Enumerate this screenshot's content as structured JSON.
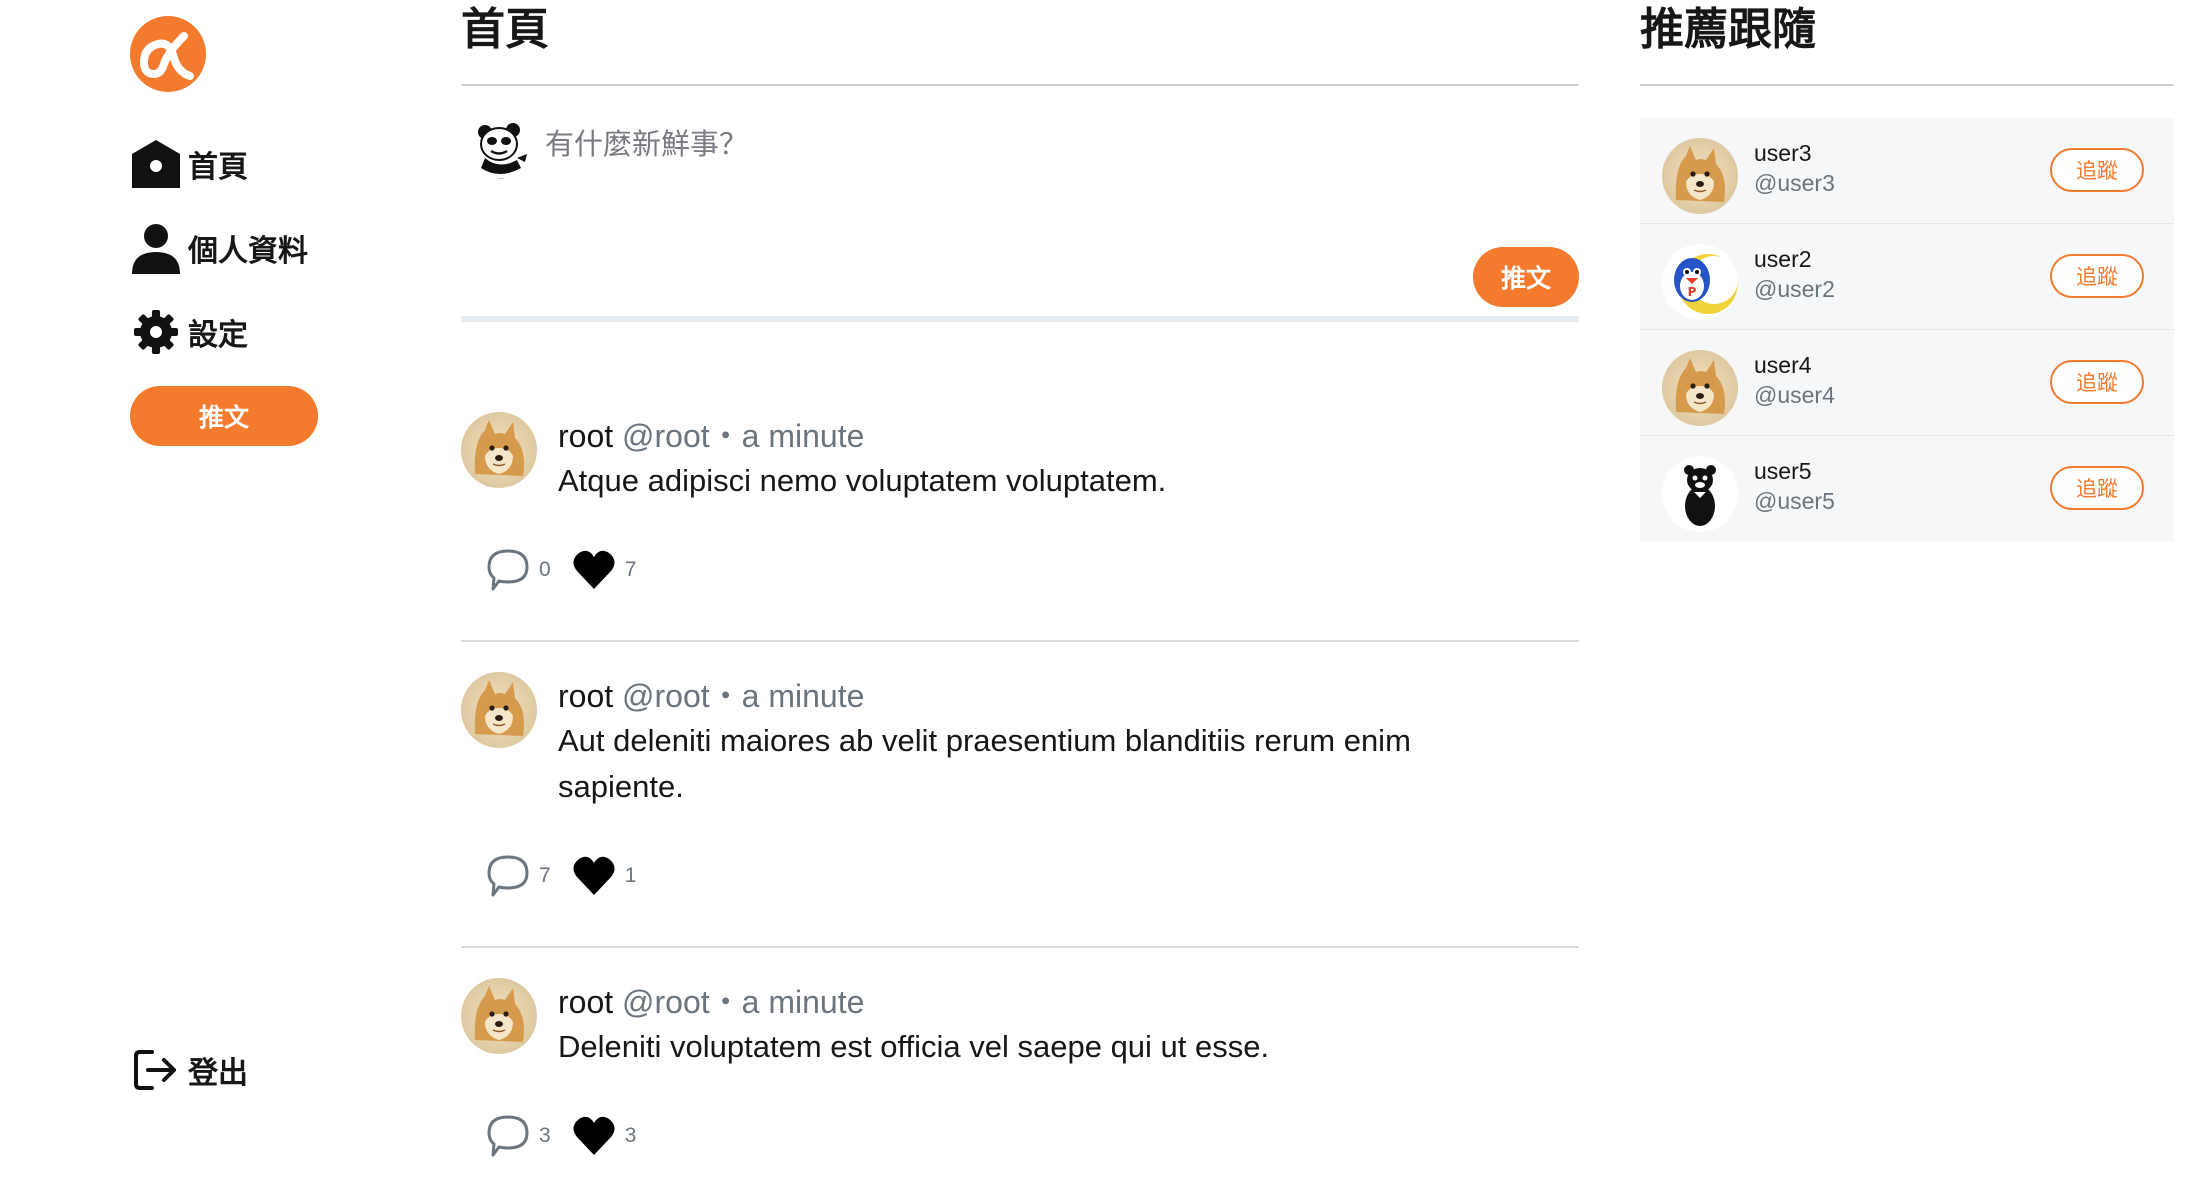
{
  "brand": {
    "logo_icon": "alpha-logo-icon",
    "accent_color": "#f47a2e"
  },
  "sidebar": {
    "items": [
      {
        "label": "首頁",
        "icon": "home-icon"
      },
      {
        "label": "個人資料",
        "icon": "user-icon"
      },
      {
        "label": "設定",
        "icon": "gear-icon"
      }
    ],
    "tweet_button": "推文",
    "logout": {
      "label": "登出",
      "icon": "logout-icon"
    }
  },
  "main": {
    "title": "首頁",
    "composer": {
      "placeholder": "有什麼新鮮事？",
      "submit_label": "推文",
      "avatar_icon": "panda-meme-avatar"
    },
    "tweets": [
      {
        "name": "root",
        "handle": "@root",
        "separator": "・",
        "time": "a minute",
        "body": "Atque adipisci nemo voluptatem voluptatem.",
        "replies": "0",
        "likes": "7"
      },
      {
        "name": "root",
        "handle": "@root",
        "separator": "・",
        "time": "a minute",
        "body": "Aut deleniti maiores ab velit praesentium blanditiis rerum enim sapiente.",
        "replies": "7",
        "likes": "1"
      },
      {
        "name": "root",
        "handle": "@root",
        "separator": "・",
        "time": "a minute",
        "body": "Deleniti voluptatem est officia vel saepe qui ut esse.",
        "replies": "3",
        "likes": "3"
      }
    ]
  },
  "right": {
    "title": "推薦跟隨",
    "suggestions": [
      {
        "name": "user3",
        "handle": "@user3",
        "follow_label": "追蹤",
        "avatar": "doge-avatar"
      },
      {
        "name": "user2",
        "handle": "@user2",
        "follow_label": "追蹤",
        "avatar": "penguin-moon-avatar"
      },
      {
        "name": "user4",
        "handle": "@user4",
        "follow_label": "追蹤",
        "avatar": "doge-avatar"
      },
      {
        "name": "user5",
        "handle": "@user5",
        "follow_label": "追蹤",
        "avatar": "black-bear-avatar"
      }
    ]
  }
}
